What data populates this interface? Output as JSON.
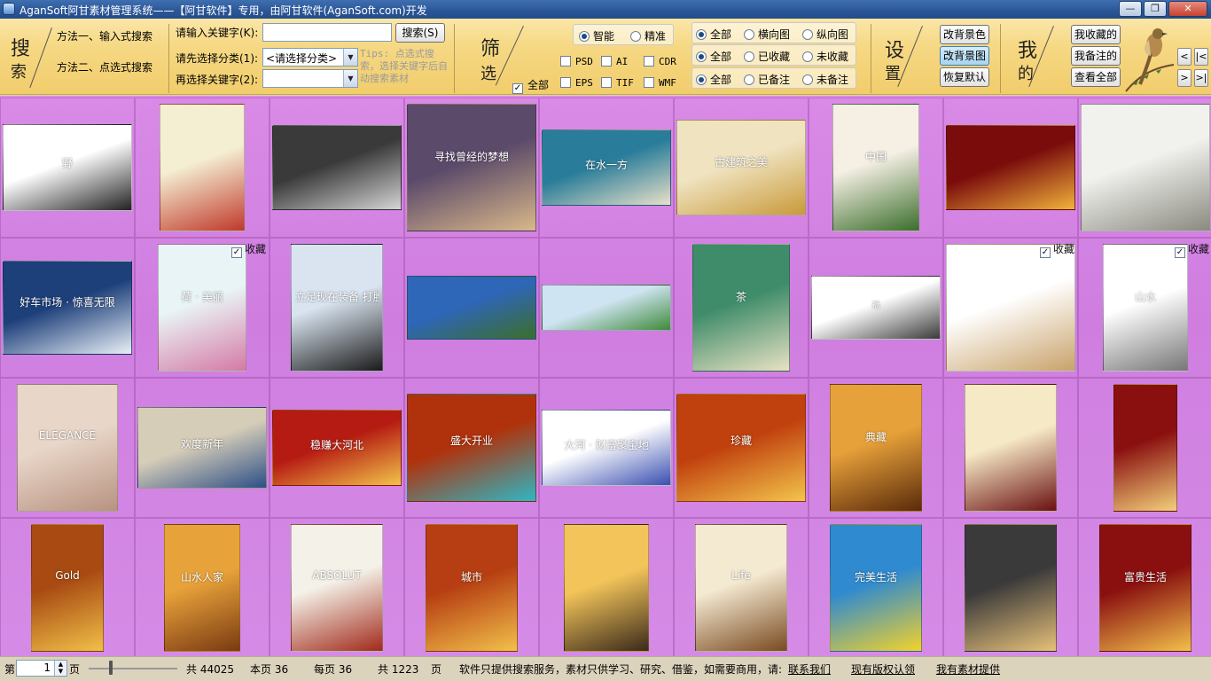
{
  "window": {
    "title": "AganSoft阿甘素材管理系统——【阿甘软件】专用，由阿甘软件(AganSoft.com)开发",
    "controls": {
      "minimize": "—",
      "maximize": "❐",
      "close": "✕"
    }
  },
  "search": {
    "section_char_1": "搜",
    "section_char_2": "索",
    "method_1": "方法一、输入式搜索",
    "method_2": "方法二、点选式搜索",
    "keyword_label": "请输入关键字(K):",
    "keyword_value": "",
    "search_button": "搜索(S)",
    "category_label": "请先选择分类(1):",
    "category_value": "<请选择分类>",
    "keyword2_label": "再选择关键字(2):",
    "keyword2_value": "",
    "tips": "Tips: 点选式搜索，选择关键字后自动搜索素材"
  },
  "filter": {
    "section_char_1": "筛",
    "section_char_2": "选",
    "mode_options": [
      {
        "label": "智能",
        "selected": true
      },
      {
        "label": "精准",
        "selected": false
      }
    ],
    "all_label": "全部",
    "all_checked": true,
    "formats": [
      {
        "label": "PSD",
        "checked": false
      },
      {
        "label": "AI",
        "checked": false
      },
      {
        "label": "CDR",
        "checked": false
      },
      {
        "label": "EPS",
        "checked": false
      },
      {
        "label": "TIF",
        "checked": false
      },
      {
        "label": "WMF",
        "checked": false
      }
    ],
    "orientation": [
      {
        "label": "全部",
        "selected": true
      },
      {
        "label": "横向图",
        "selected": false
      },
      {
        "label": "纵向图",
        "selected": false
      }
    ],
    "favorite": [
      {
        "label": "全部",
        "selected": true
      },
      {
        "label": "已收藏",
        "selected": false
      },
      {
        "label": "未收藏",
        "selected": false
      }
    ],
    "notes": [
      {
        "label": "全部",
        "selected": true
      },
      {
        "label": "已备注",
        "selected": false
      },
      {
        "label": "未备注",
        "selected": false
      }
    ]
  },
  "settings": {
    "section_char_1": "设",
    "section_char_2": "置",
    "change_bg_color": "改背景色",
    "change_bg_image": "改背景图",
    "restore_default": "恢复默认"
  },
  "mine": {
    "section_char_1": "我",
    "section_char_2": "的",
    "my_favorites": "我收藏的",
    "my_notes": "我备注的",
    "view_all": "查看全部"
  },
  "nav": {
    "prev": "<",
    "first": "|<",
    "next": ">",
    "last": ">|"
  },
  "gallery": {
    "favorite_label": "收藏",
    "items": [
      {
        "caption": "野",
        "fav": false,
        "colors": [
          "#ffffff",
          "#222222"
        ]
      },
      {
        "caption": "",
        "fav": false,
        "colors": [
          "#f4eed2",
          "#c0392b"
        ]
      },
      {
        "caption": "",
        "fav": false,
        "colors": [
          "#3a3a3a",
          "#d5d5d5"
        ]
      },
      {
        "caption": "寻找曾经的梦想",
        "fav": false,
        "colors": [
          "#5b4a6a",
          "#d9b88a"
        ]
      },
      {
        "caption": "在水一方",
        "fav": false,
        "colors": [
          "#2a7d9a",
          "#e9e0c8"
        ]
      },
      {
        "caption": "古建筑之美",
        "fav": false,
        "colors": [
          "#efe3c0",
          "#c99a3a"
        ]
      },
      {
        "caption": "中国",
        "fav": false,
        "colors": [
          "#f5efe4",
          "#3b6e2c"
        ]
      },
      {
        "caption": "",
        "fav": false,
        "colors": [
          "#7a0c0c",
          "#f2b23b"
        ]
      },
      {
        "caption": "",
        "fav": false,
        "colors": [
          "#f1f1ee",
          "#8a8a80"
        ]
      },
      {
        "caption": "好车市场 · 惊喜无限",
        "fav": false,
        "colors": [
          "#1d3f7a",
          "#e9f0f7"
        ]
      },
      {
        "caption": "荷 · 美丽",
        "fav": true,
        "colors": [
          "#e9f4f6",
          "#d47aa5"
        ]
      },
      {
        "caption": "立足现在装备 打胜仗",
        "fav": false,
        "colors": [
          "#d9e4f0",
          "#1a1a1a"
        ]
      },
      {
        "caption": "",
        "fav": false,
        "colors": [
          "#2e66b8",
          "#3c6e2a"
        ]
      },
      {
        "caption": "",
        "fav": false,
        "colors": [
          "#cfe4f2",
          "#3f8a3a"
        ]
      },
      {
        "caption": "茶",
        "fav": false,
        "colors": [
          "#3f8c6a",
          "#e8e2c3"
        ]
      },
      {
        "caption": "福",
        "fav": false,
        "colors": [
          "#ffffff",
          "#3a3a3a"
        ]
      },
      {
        "caption": "",
        "fav": true,
        "colors": [
          "#ffffff",
          "#c9a26a"
        ]
      },
      {
        "caption": "山水",
        "fav": true,
        "colors": [
          "#ffffff",
          "#777777"
        ]
      },
      {
        "caption": "ELEGANCE",
        "fav": false,
        "colors": [
          "#e8d6c9",
          "#b89280"
        ]
      },
      {
        "caption": "欢度新年",
        "fav": false,
        "colors": [
          "#d6cdb8",
          "#2d4f86"
        ]
      },
      {
        "caption": "稳赚大河北",
        "fav": false,
        "colors": [
          "#b51b12",
          "#f2c34a"
        ]
      },
      {
        "caption": "盛大开业",
        "fav": false,
        "colors": [
          "#b0320c",
          "#2fb7c4"
        ]
      },
      {
        "caption": "大河 · 财富聚宝地",
        "fav": false,
        "colors": [
          "#ffffff",
          "#3a4fb0"
        ]
      },
      {
        "caption": "珍藏",
        "fav": false,
        "colors": [
          "#c0400e",
          "#f3c54b"
        ]
      },
      {
        "caption": "典藏",
        "fav": false,
        "colors": [
          "#e7a13a",
          "#5a2a0a"
        ]
      },
      {
        "caption": "",
        "fav": false,
        "colors": [
          "#f6e9c6",
          "#6a1010"
        ]
      },
      {
        "caption": "",
        "fav": false,
        "colors": [
          "#8a1010",
          "#f2d07a"
        ]
      },
      {
        "caption": "Gold",
        "fav": false,
        "colors": [
          "#a84a12",
          "#f0c048"
        ]
      },
      {
        "caption": "山水人家",
        "fav": false,
        "colors": [
          "#e8a23a",
          "#7a3a12"
        ]
      },
      {
        "caption": "ABSOLUT",
        "fav": false,
        "colors": [
          "#f4f1e8",
          "#a12a1a"
        ]
      },
      {
        "caption": "城市",
        "fav": false,
        "colors": [
          "#b63e12",
          "#f2c04a"
        ]
      },
      {
        "caption": "",
        "fav": false,
        "colors": [
          "#f3c45a",
          "#3a2a1a"
        ]
      },
      {
        "caption": "Life",
        "fav": false,
        "colors": [
          "#f4ead2",
          "#7a4a20"
        ]
      },
      {
        "caption": "完美生活",
        "fav": false,
        "colors": [
          "#2f8ad0",
          "#f3d22a"
        ]
      },
      {
        "caption": "",
        "fav": false,
        "colors": [
          "#3a3a3a",
          "#e7c07a"
        ]
      },
      {
        "caption": "富贵生活",
        "fav": false,
        "colors": [
          "#8a1010",
          "#f2c04a"
        ]
      }
    ]
  },
  "status": {
    "page_prefix": "第",
    "page_value": "1",
    "page_suffix": "页",
    "total": "共 44025",
    "this_page": "本页 36",
    "per_page": "每页 36",
    "total_pages": "共 1223",
    "pages_unit": "页",
    "notice": "软件只提供搜索服务，素材只供学习、研究、借鉴，如需要商用，请:",
    "contact_link": "联系我们",
    "copyright_link": "现有版权认领",
    "provide_link": "我有素材提供"
  }
}
